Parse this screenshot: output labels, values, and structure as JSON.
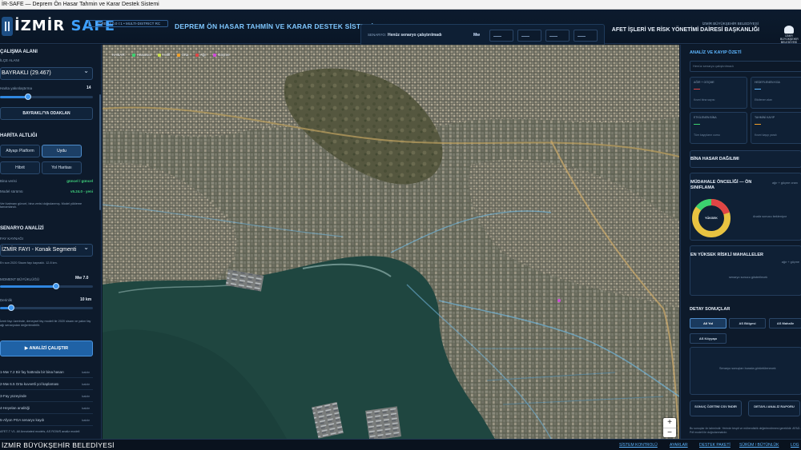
{
  "window": {
    "title": "İR-SAFE — Deprem Ön Hasar Tahmin ve Karar Destek Sistemi"
  },
  "header": {
    "brand_main": "İZMİR",
    "brand_accent": "SAFE",
    "version": "CORE v4.0.0 r:1 • MULTI-DISTRICT RC",
    "app_title": "DEPREM ÖN HASAR TAHMİN VE KARAR DESTEK SİSTEMİ",
    "scenario_label": "SENARYO:",
    "scenario_text": "Henüz senaryo çalıştırılmadı",
    "scenario_mw": "Mw",
    "scenario_chips": [
      "—",
      "—",
      "—",
      "—"
    ],
    "org_top": "İZMİR BÜYÜKŞEHİR BELEDİYESİ",
    "org_main": "AFET İŞLERİ VE RİSK YÖNETİMİ DAİRESİ BAŞKANLIĞI",
    "emblem_text": "İZMİR BÜYÜKŞEHİR BELEDİYESİ"
  },
  "left": {
    "area_title": "ÇALIŞMA ALANI",
    "area_label": "İLÇE ALANI",
    "district_value": "BAYRAKLI (29.467)",
    "zoom_label": "Harita yakınlaştırma",
    "zoom_value": "14",
    "zoom_level": 0.3,
    "focus_button": "BAYRAKLI'YA ODAKLAN",
    "basemap_title": "HARİTA ALTLIĞI",
    "basemap_options": [
      "Altyapı Platform",
      "Uydu",
      "Hibrit",
      "Yol Haritası"
    ],
    "basemap_active": "Uydu",
    "status_rows": [
      {
        "label": "Bina verisi",
        "value": "güncel / güncel"
      },
      {
        "label": "Model sürümü",
        "value": "v5.24.0 - yeni"
      }
    ],
    "status_note": "Veri katmanı güncel, bina verisi doğrulanmış. Model yükleme tamamlandı.",
    "scenario_title": "SENARYO ANALİZİ",
    "fault_label": "FAY KAYNAĞI",
    "fault_value": "İZMİR FAYI - Konak Segmenti",
    "fault_note": "En son 2020 Sisam fayı kaynaklı. 12.8 km.",
    "magnitude_label": "MOMENT BÜYÜKLÜĞÜ",
    "magnitude_value": "Mw 7.0",
    "magnitude_level": 0.6,
    "depth_label": "Derinlik",
    "depth_value": "10 km",
    "depth_level": 0.12,
    "scenario_note": "İzmir fayı üzerinde, deneysel fay modeli ile 2020 sisam ve yakın fay ağı senaryoları değerlendirilir.",
    "run_button": "▶ ANALİZİ ÇALIŞTIR",
    "history_rows": [
      {
        "label": "1-Mw 7.2 Bir fay hattında bir bina hasarı",
        "action": "kaldır"
      },
      {
        "label": "2-Mw 6.5 Orta kuvvetli yol kaplaması",
        "action": "kaldır"
      },
      {
        "label": "3-Fay yüzeyinde",
        "action": "kaldır"
      },
      {
        "label": "4-Heyelan analitiği",
        "action": "kaldır"
      },
      {
        "label": "5-Afyon PGA senaryo kaydı",
        "action": "kaldır"
      }
    ],
    "footer_note": "AFET-T V1. All Annotated models, AS ROWS analiz modeli"
  },
  "map": {
    "legend_title": "HASAR:",
    "legend": [
      {
        "label": "Hasarsız",
        "color": "#3bd16f"
      },
      {
        "label": "Hafif",
        "color": "#c8e04a"
      },
      {
        "label": "Orta",
        "color": "#f0a02a"
      },
      {
        "label": "Ağır",
        "color": "#e04545"
      },
      {
        "label": "Göçme",
        "color": "#d04bd8"
      }
    ],
    "zoom_in": "+",
    "zoom_out": "−"
  },
  "right": {
    "summary_title": "ANALİZ VE KAYIP ÖZETİ",
    "summary_input": "Henüz senaryo çalıştırılmadı",
    "kpis": [
      {
        "label": "AĞIR + GÖÇME",
        "value": "—",
        "sub": "Kısmi bina sayısı",
        "color": "#e04545"
      },
      {
        "label": "HEDEFLENEN KGA",
        "value": "—",
        "sub": "Etkilenen alan",
        "color": "#5db6ff"
      },
      {
        "label": "ETKİLENEN BİNA",
        "value": "—",
        "sub": "Tüm kayıpların cumu",
        "color": "#3bd16f"
      },
      {
        "label": "TAHMİNİ KAYIP",
        "value": "—",
        "sub": "Kısmi kayıp yaralı",
        "color": "#f0a02a"
      }
    ],
    "damage_title": "BİNA HASAR DAĞILIMI",
    "priority_title": "MÜDAHALE ÖNCELİĞİ — ÖN SINIFLAMA",
    "priority_tag": "ağır + göçme oranı",
    "donut_label": "YÜKSEK",
    "priority_hint": "Analiz sonucu bekleniyor",
    "risk_title": "EN YÜKSEK RİSKLİ MAHALLELER",
    "risk_tag": "ağır + göçme",
    "risk_hint": "senaryo sonucu gösterilecek",
    "detail_title": "DETAY SONUÇLAR",
    "tabs": [
      "All Yol",
      "AS Bölgesi",
      "AS Mahalle",
      "AS Köyyapı"
    ],
    "tabs_active": "All Yol",
    "detail_hint": "Senaryo sonuçları burada görüntülenecek",
    "btn_csv": "SONUÇ ÖZETİNİ CSV İNDİR",
    "btn_report": "DETAYLI ANALİZ RAPORU",
    "note": "Bu sonuçlar ön tahmindir. Yerinde tespit ve mühendislik değerlendirmesi gereklidir. AFAD-Pdf modeli ile doğrulanmalıdır."
  },
  "footer": {
    "org": "İZMİR BÜYÜKŞEHİR BELEDİYESİ",
    "links": [
      "SİSTEM KONTROLÜ",
      "AYARLAR",
      "DESTEK PAKETİ",
      "SÜRÜM / BÜTÜNLÜK",
      "LOG"
    ]
  }
}
